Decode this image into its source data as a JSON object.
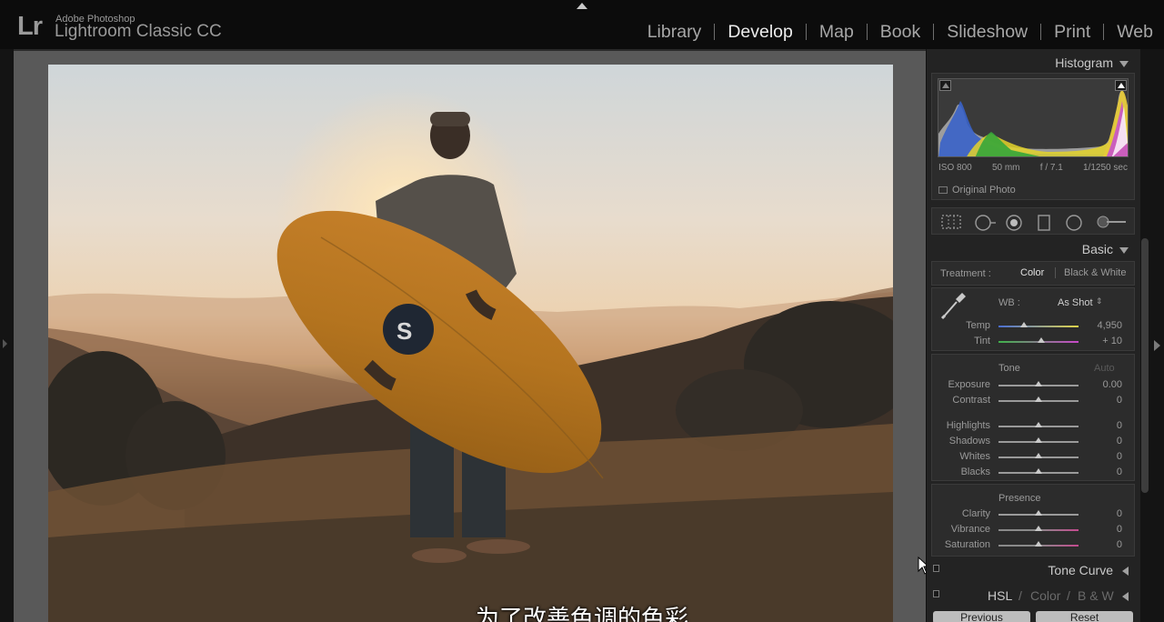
{
  "app": {
    "logo": "Lr",
    "vendor": "Adobe Photoshop",
    "product": "Lightroom Classic CC"
  },
  "modules": [
    {
      "label": "Library",
      "active": false
    },
    {
      "label": "Develop",
      "active": true
    },
    {
      "label": "Map",
      "active": false
    },
    {
      "label": "Book",
      "active": false
    },
    {
      "label": "Slideshow",
      "active": false
    },
    {
      "label": "Print",
      "active": false
    },
    {
      "label": "Web",
      "active": false
    }
  ],
  "histogram": {
    "title": "Histogram",
    "iso": "ISO 800",
    "focal": "50 mm",
    "aperture": "f / 7.1",
    "shutter": "1/1250 sec",
    "original_photo": "Original Photo"
  },
  "tools": [
    "crop-overlay-icon",
    "spot-removal-icon",
    "red-eye-icon",
    "graduated-filter-icon",
    "radial-filter-icon",
    "adjustment-brush-icon"
  ],
  "basic": {
    "title": "Basic",
    "treatment_label": "Treatment :",
    "treatment_color": "Color",
    "treatment_bw": "Black & White",
    "wb_label": "WB :",
    "wb_value": "As Shot",
    "temp_label": "Temp",
    "temp_value": "4,950",
    "tint_label": "Tint",
    "tint_value": "+ 10",
    "tone_label": "Tone",
    "auto_label": "Auto",
    "exposure_label": "Exposure",
    "exposure_value": "0.00",
    "contrast_label": "Contrast",
    "contrast_value": "0",
    "highlights_label": "Highlights",
    "highlights_value": "0",
    "shadows_label": "Shadows",
    "shadows_value": "0",
    "whites_label": "Whites",
    "whites_value": "0",
    "blacks_label": "Blacks",
    "blacks_value": "0",
    "presence_label": "Presence",
    "clarity_label": "Clarity",
    "clarity_value": "0",
    "vibrance_label": "Vibrance",
    "vibrance_value": "0",
    "saturation_label": "Saturation",
    "saturation_value": "0"
  },
  "tone_curve": {
    "title": "Tone Curve"
  },
  "hsl": {
    "hsl": "HSL",
    "color": "Color",
    "bw": "B & W"
  },
  "bottom_buttons": {
    "previous": "Previous",
    "reset": "Reset"
  },
  "subtitle": "为了改善色调的色彩",
  "colors": {
    "background": "#0e0e0e",
    "panel": "#232323",
    "canvas": "#595959",
    "active_module": "#ececec",
    "inactive_module": "#a7a7a7"
  }
}
